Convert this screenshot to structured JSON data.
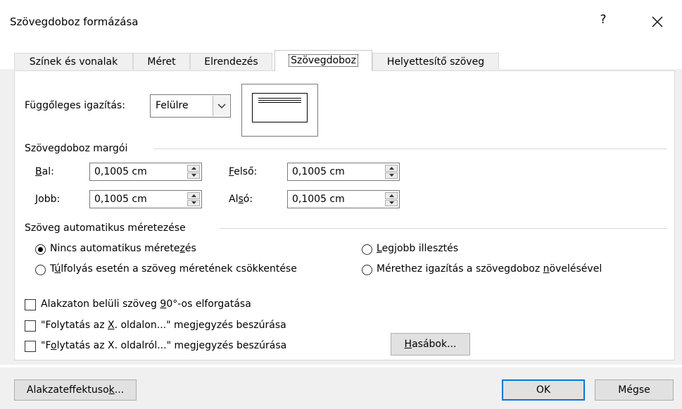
{
  "window": {
    "title": "Szövegdoboz formázása",
    "help_label": "?",
    "close_icon": "close-icon"
  },
  "tabs": [
    {
      "label": "Színek és vonalak",
      "active": false
    },
    {
      "label": "Méret",
      "active": false
    },
    {
      "label": "Elrendezés",
      "active": false
    },
    {
      "label": "Szövegdoboz",
      "active": true
    },
    {
      "label": "Helyettesítő szöveg",
      "active": false
    }
  ],
  "vertical_alignment": {
    "label_pre": "Fü",
    "label_u": "g",
    "label_post": "gőleges igazítás:",
    "value": "Felülre",
    "icon": "chevron-down-icon"
  },
  "margins": {
    "group_title": "Szövegdoboz margói",
    "left": {
      "label_u": "B",
      "label_post": "al:",
      "value": "0,1005 cm"
    },
    "right": {
      "label_u": "J",
      "label_post": "obb:",
      "value": "0,1005 cm"
    },
    "top": {
      "label_u": "F",
      "label_post": "első:",
      "value": "0,1005 cm"
    },
    "bottom": {
      "label_pre": "Al",
      "label_u": "s",
      "label_post": "ó:",
      "value": "0,1005 cm"
    }
  },
  "autofit": {
    "group_title": "Szöveg automatikus méretezése",
    "options": [
      {
        "pre": "Nincs automatikus mérete",
        "u": "z",
        "post": "és",
        "checked": true
      },
      {
        "pre": "",
        "u": "L",
        "post": "egjobb illesztés",
        "checked": false
      },
      {
        "pre": "T",
        "u": "ú",
        "post": "lfolyás esetén a szöveg méretének csökkentése",
        "checked": false
      },
      {
        "pre": "Mérethez igazítás a szövegdoboz ",
        "u": "n",
        "post": "övelésével",
        "checked": false
      }
    ]
  },
  "checkboxes": [
    {
      "pre": "Alakzaton belüli szöveg ",
      "u": "9",
      "post": "0°-os elforgatása",
      "checked": false
    },
    {
      "pre": "\"Folytatás az ",
      "u": "X",
      "post": ". oldalon...\" megjegyzés beszúrása",
      "checked": false
    },
    {
      "pre": "\"F",
      "u": "o",
      "post": "lytatás az X. oldalról...\" megjegyzés beszúrása",
      "checked": false
    }
  ],
  "buttons": {
    "columns": {
      "u": "H",
      "post": "asábok..."
    },
    "shape_effects": {
      "pre": "Alakzateffektuso",
      "u": "k",
      "post": "..."
    },
    "ok": "OK",
    "cancel": "Mégse"
  }
}
